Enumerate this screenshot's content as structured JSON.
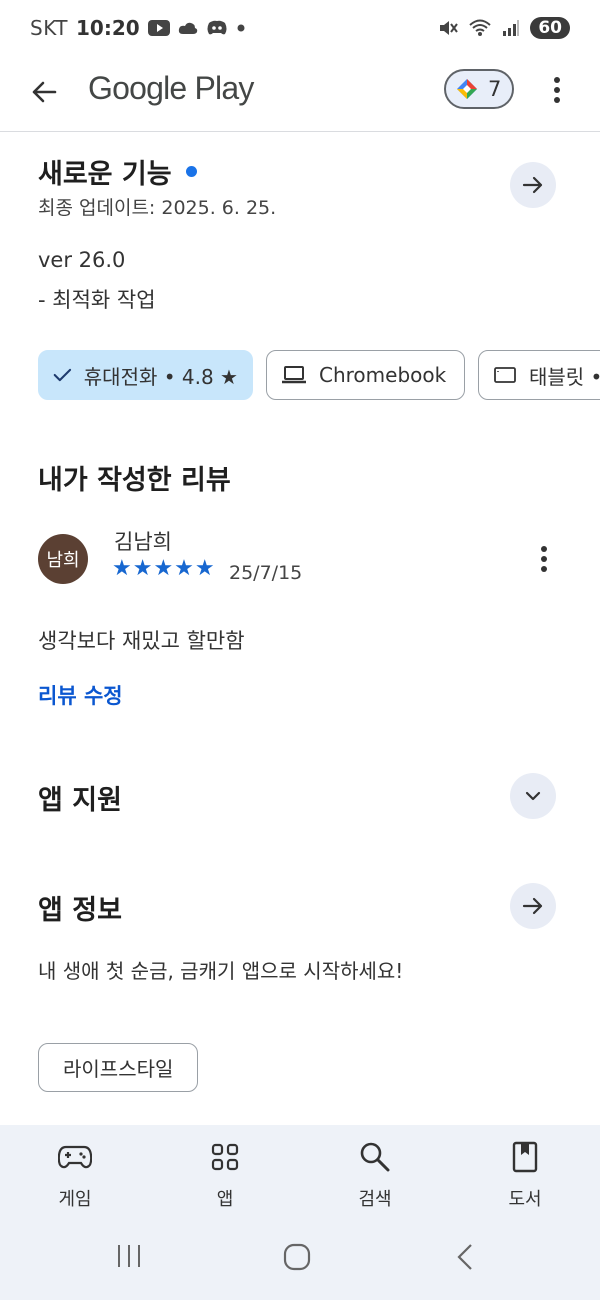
{
  "status_bar": {
    "carrier": "SKT",
    "time": "10:20",
    "battery": "60"
  },
  "app_bar": {
    "title": "Google Play",
    "points": "7"
  },
  "whats_new": {
    "heading": "새로운 기능",
    "updated": "최종 업데이트: 2025. 6. 25.",
    "version": "ver 26.0",
    "note": "- 최적화 작업"
  },
  "device_chips": [
    {
      "label": "휴대전화 • 4.8 ★",
      "selected": true
    },
    {
      "label": "Chromebook",
      "selected": false
    },
    {
      "label": "태블릿 •",
      "selected": false
    }
  ],
  "my_review": {
    "heading": "내가 작성한 리뷰",
    "avatar_text": "남희",
    "reviewer": "김남희",
    "rating": 5,
    "stars": "★★★★★",
    "date": "25/7/15",
    "text": "생각보다 재밌고 할만함",
    "edit_label": "리뷰 수정"
  },
  "app_support": {
    "heading": "앱 지원"
  },
  "app_info": {
    "heading": "앱 정보",
    "description": "내 생애 첫 순금, 금캐기 앱으로 시작하세요!",
    "category": "라이프스타일"
  },
  "bottom_nav": [
    {
      "label": "게임",
      "icon": "gamepad-icon"
    },
    {
      "label": "앱",
      "icon": "apps-grid-icon"
    },
    {
      "label": "검색",
      "icon": "search-icon"
    },
    {
      "label": "도서",
      "icon": "book-icon"
    }
  ],
  "colors": {
    "accent_blue": "#0b57d0",
    "chip_selected": "#c8e6fb",
    "nav_bg": "#eef2f8",
    "avatar_bg": "#5b4033"
  }
}
